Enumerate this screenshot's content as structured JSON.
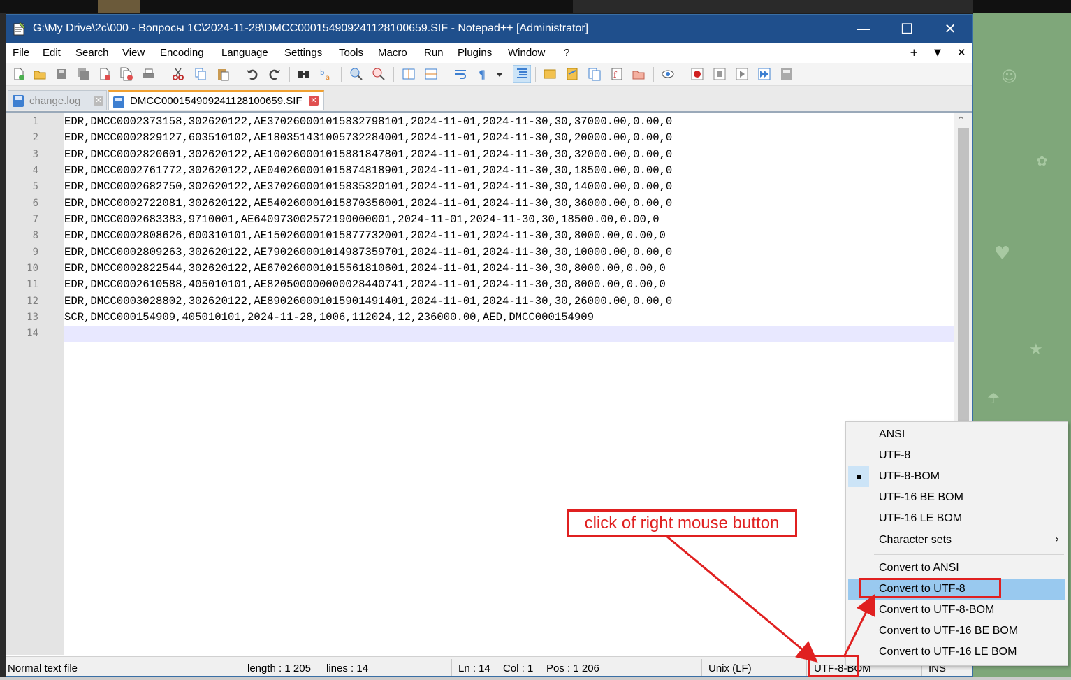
{
  "window": {
    "title": "G:\\My Drive\\2c\\000 - Вопросы 1C\\2024-11-28\\DMCC000154909241128100659.SIF - Notepad++ [Administrator]",
    "minimize_glyph": "—",
    "maximize_glyph": "☐",
    "close_glyph": "✕"
  },
  "menu": {
    "items": [
      "File",
      "Edit",
      "Search",
      "View",
      "Encoding",
      "Language",
      "Settings",
      "Tools",
      "Macro",
      "Run",
      "Plugins",
      "Window",
      "?"
    ],
    "right_plus": "+",
    "right_down": "▼",
    "right_close": "✕"
  },
  "toolbar": {
    "icons": [
      "new-file-icon",
      "open-file-icon",
      "save-icon",
      "save-all-icon",
      "close-file-icon",
      "close-all-icon",
      "print-icon",
      "cut-icon",
      "copy-icon",
      "paste-icon",
      "undo-icon",
      "redo-icon",
      "find-icon",
      "replace-icon",
      "zoom-in-icon",
      "zoom-out-icon",
      "sync-vertical-icon",
      "sync-horizontal-icon",
      "word-wrap-icon",
      "show-all-chars-icon",
      "dropdown-icon",
      "indent-guide-icon",
      "user-language-icon",
      "doc-map-icon",
      "doc-list-icon",
      "function-list-icon",
      "folder-workspace-icon",
      "monitoring-icon",
      "record-macro-icon",
      "stop-macro-icon",
      "play-macro-icon",
      "run-macro-multiple-icon",
      "save-macro-icon"
    ]
  },
  "tabs": [
    {
      "label": "change.log",
      "active": false
    },
    {
      "label": "DMCC000154909241128100659.SIF",
      "active": true
    }
  ],
  "editor": {
    "current_line": 14,
    "lines": [
      "EDR,DMCC0002373158,302620122,AE370260001015832798101,2024-11-01,2024-11-30,30,37000.00,0.00,0",
      "EDR,DMCC0002829127,603510102,AE180351431005732284001,2024-11-01,2024-11-30,30,20000.00,0.00,0",
      "EDR,DMCC0002820601,302620122,AE100260001015881847801,2024-11-01,2024-11-30,30,32000.00,0.00,0",
      "EDR,DMCC0002761772,302620122,AE040260001015874818901,2024-11-01,2024-11-30,30,18500.00,0.00,0",
      "EDR,DMCC0002682750,302620122,AE370260001015835320101,2024-11-01,2024-11-30,30,14000.00,0.00,0",
      "EDR,DMCC0002722081,302620122,AE540260001015870356001,2024-11-01,2024-11-30,30,36000.00,0.00,0",
      "EDR,DMCC0002683383,9710001,AE640973002572190000001,2024-11-01,2024-11-30,30,18500.00,0.00,0",
      "EDR,DMCC0002808626,600310101,AE150260001015877732001,2024-11-01,2024-11-30,30,8000.00,0.00,0",
      "EDR,DMCC0002809263,302620122,AE790260001014987359701,2024-11-01,2024-11-30,30,10000.00,0.00,0",
      "EDR,DMCC0002822544,302620122,AE670260001015561810601,2024-11-01,2024-11-30,30,8000.00,0.00,0",
      "EDR,DMCC0002610588,405010101,AE820500000000028440741,2024-11-01,2024-11-30,30,8000.00,0.00,0",
      "EDR,DMCC0003028802,302620122,AE890260001015901491401,2024-11-01,2024-11-30,30,26000.00,0.00,0",
      "SCR,DMCC000154909,405010101,2024-11-28,1006,112024,12,236000.00,AED,DMCC000154909",
      ""
    ]
  },
  "status": {
    "file_type": "Normal text file",
    "length": "length : 1 205",
    "lines": "lines : 14",
    "ln": "Ln : 14",
    "col": "Col : 1",
    "pos": "Pos : 1 206",
    "eol": "Unix (LF)",
    "encoding": "UTF-8-BOM",
    "ins": "INS"
  },
  "context_menu": {
    "items": [
      {
        "label": "ANSI",
        "checked": false
      },
      {
        "label": "UTF-8",
        "checked": false
      },
      {
        "label": "UTF-8-BOM",
        "checked": true
      },
      {
        "label": "UTF-16 BE BOM",
        "checked": false
      },
      {
        "label": "UTF-16 LE BOM",
        "checked": false
      },
      {
        "label": "Character sets",
        "submenu": true
      }
    ],
    "convert_items": [
      {
        "label": "Convert to ANSI",
        "highlighted": false
      },
      {
        "label": "Convert to UTF-8",
        "highlighted": true
      },
      {
        "label": "Convert to UTF-8-BOM",
        "highlighted": false
      },
      {
        "label": "Convert to UTF-16 BE BOM",
        "highlighted": false
      },
      {
        "label": "Convert to UTF-16 LE BOM",
        "highlighted": false
      }
    ],
    "submenu_arrow": "›"
  },
  "annotation": {
    "callout_text": "click of right mouse button",
    "color": "#e02020"
  },
  "colors": {
    "titlebar": "#1f4f8c",
    "current_line": "#e8e8ff",
    "menu_highlight": "#99c9ef",
    "accent_tab": "#f0a030"
  }
}
